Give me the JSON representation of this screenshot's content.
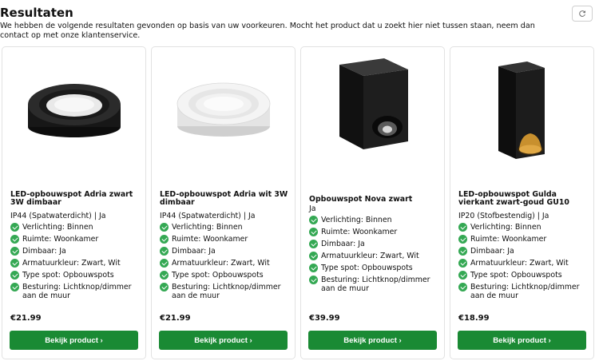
{
  "page": {
    "title": "Resultaten",
    "intro": "We hebben de volgende resultaten gevonden op basis van uw voorkeuren. Mocht het product dat u zoekt hier niet tussen staan, neem dan contact op met onze klantenservice.",
    "refresh_icon": "refresh-icon"
  },
  "products": [
    {
      "name": "LED-opbouwspot Adria zwart 3W dimbaar",
      "subtitle": "IP44 (Spatwaterdicht) | Ja",
      "features": [
        "Verlichting: Binnen",
        "Ruimte: Woonkamer",
        "Dimbaar: Ja",
        "Armatuurkleur: Zwart, Wit",
        "Type spot: Opbouwspots",
        "Besturing: Lichtknop/dimmer aan de muur"
      ],
      "price": "€21.99",
      "button": "Bekijk product ›"
    },
    {
      "name": "LED-opbouwspot Adria wit 3W dimbaar",
      "subtitle": "IP44 (Spatwaterdicht) | Ja",
      "features": [
        "Verlichting: Binnen",
        "Ruimte: Woonkamer",
        "Dimbaar: Ja",
        "Armatuurkleur: Zwart, Wit",
        "Type spot: Opbouwspots",
        "Besturing: Lichtknop/dimmer aan de muur"
      ],
      "price": "€21.99",
      "button": "Bekijk product ›"
    },
    {
      "name": "Opbouwspot Nova zwart",
      "subtitle": "Ja",
      "features": [
        "Verlichting: Binnen",
        "Ruimte: Woonkamer",
        "Dimbaar: Ja",
        "Armatuurkleur: Zwart, Wit",
        "Type spot: Opbouwspots",
        "Besturing: Lichtknop/dimmer aan de muur"
      ],
      "price": "€39.99",
      "button": "Bekijk product ›"
    },
    {
      "name": "LED-opbouwspot Gulda vierkant zwart-goud GU10",
      "subtitle": "IP20 (Stofbestendig) | Ja",
      "features": [
        "Verlichting: Binnen",
        "Ruimte: Woonkamer",
        "Dimbaar: Ja",
        "Armatuurkleur: Zwart, Wit",
        "Type spot: Opbouwspots",
        "Besturing: Lichtknop/dimmer aan de muur"
      ],
      "price": "€18.99",
      "button": "Bekijk product ›"
    }
  ],
  "colors": {
    "button_bg": "#1a8a34",
    "check": "#34a853"
  }
}
